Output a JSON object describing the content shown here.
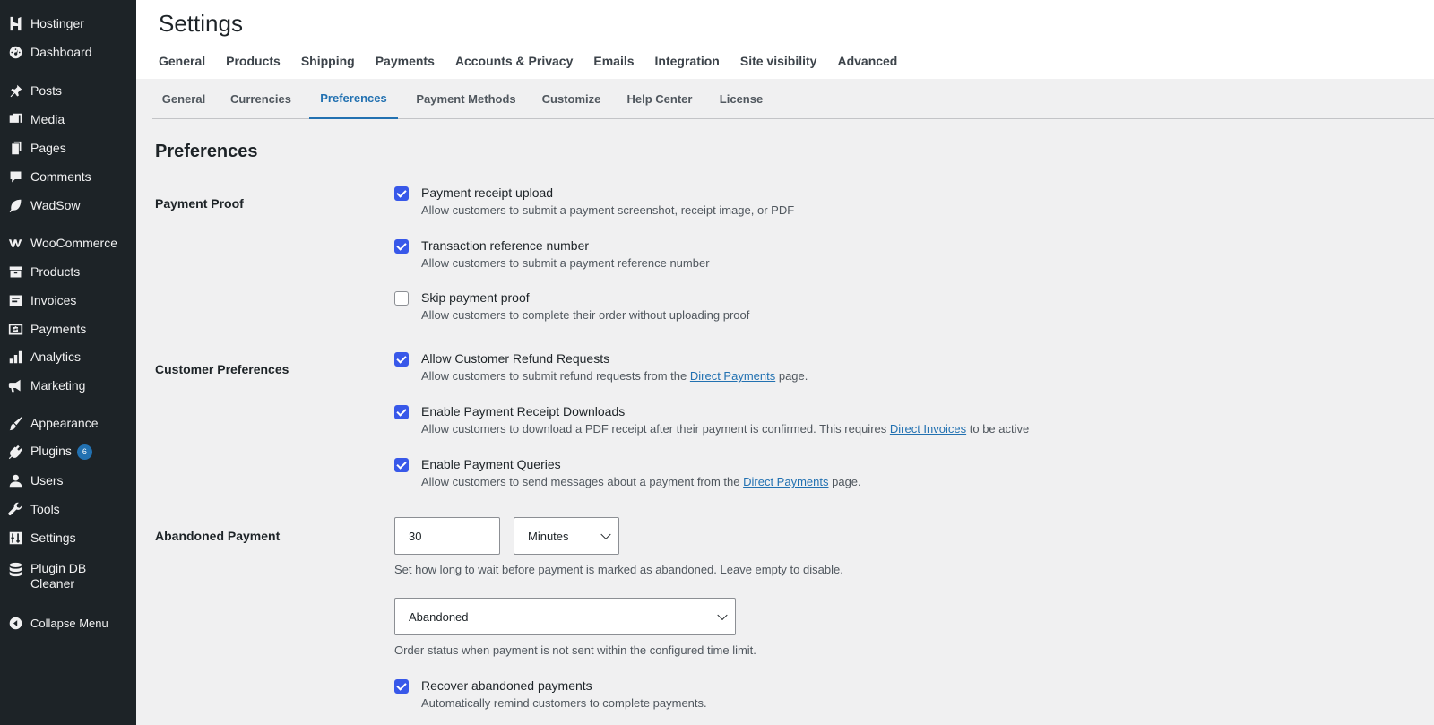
{
  "sidebar": {
    "items": [
      {
        "label": "Hostinger",
        "icon": "hostinger-icon"
      },
      {
        "label": "Dashboard",
        "icon": "dashboard-icon"
      },
      {
        "label": "Posts",
        "icon": "pin-icon"
      },
      {
        "label": "Media",
        "icon": "media-icon"
      },
      {
        "label": "Pages",
        "icon": "pages-icon"
      },
      {
        "label": "Comments",
        "icon": "comment-icon"
      },
      {
        "label": "WadSow",
        "icon": "leaf-icon"
      },
      {
        "label": "WooCommerce",
        "icon": "woo-icon"
      },
      {
        "label": "Products",
        "icon": "archive-icon"
      },
      {
        "label": "Invoices",
        "icon": "invoice-icon"
      },
      {
        "label": "Payments",
        "icon": "dollar-icon"
      },
      {
        "label": "Analytics",
        "icon": "bar-chart-icon"
      },
      {
        "label": "Marketing",
        "icon": "megaphone-icon"
      },
      {
        "label": "Appearance",
        "icon": "brush-icon"
      },
      {
        "label": "Plugins",
        "icon": "plug-icon",
        "badge": "6"
      },
      {
        "label": "Users",
        "icon": "user-icon"
      },
      {
        "label": "Tools",
        "icon": "wrench-icon"
      },
      {
        "label": "Settings",
        "icon": "settings-icon"
      },
      {
        "label": "Plugin DB Cleaner",
        "icon": "database-icon"
      },
      {
        "label": "Collapse Menu",
        "icon": "collapse-icon"
      }
    ]
  },
  "header": {
    "title": "Settings",
    "tabs": [
      "General",
      "Products",
      "Shipping",
      "Payments",
      "Accounts & Privacy",
      "Emails",
      "Integration",
      "Site visibility",
      "Advanced"
    ]
  },
  "subtabs": {
    "items": [
      "General",
      "Currencies",
      "Preferences",
      "Payment Methods",
      "Customize",
      "Help Center",
      "License"
    ],
    "active": "Preferences"
  },
  "content": {
    "title": "Preferences",
    "payment_proof": {
      "label": "Payment Proof",
      "options": [
        {
          "title": "Payment receipt upload",
          "desc": "Allow customers to submit a payment screenshot, receipt image, or PDF",
          "checked": true
        },
        {
          "title": "Transaction reference number",
          "desc": "Allow customers to submit a payment reference number",
          "checked": true
        },
        {
          "title": "Skip payment proof",
          "desc": "Allow customers to complete their order without uploading proof",
          "checked": false
        }
      ]
    },
    "customer_prefs": {
      "label": "Customer Preferences",
      "options": [
        {
          "title": "Allow Customer Refund Requests",
          "desc_pre": "Allow customers to submit refund requests from the ",
          "link": "Direct Payments",
          "desc_post": " page.",
          "checked": true
        },
        {
          "title": "Enable Payment Receipt Downloads",
          "desc_pre": "Allow customers to download a PDF receipt after their payment is confirmed. This requires ",
          "link": "Direct Invoices",
          "desc_post": " to be active",
          "checked": true
        },
        {
          "title": "Enable Payment Queries",
          "desc_pre": "Allow customers to send messages about a payment from the ",
          "link": "Direct Payments",
          "desc_post": " page.",
          "checked": true
        }
      ]
    },
    "abandoned": {
      "label": "Abandoned Payment",
      "wait_value": "30",
      "unit": "Minutes",
      "wait_help": "Set how long to wait before payment is marked as abandoned. Leave empty to disable.",
      "status": "Abandoned",
      "status_help": "Order status when payment is not sent within the configured time limit.",
      "recover": {
        "title": "Recover abandoned payments",
        "desc": "Automatically remind customers to complete payments.",
        "checked": true
      }
    }
  }
}
